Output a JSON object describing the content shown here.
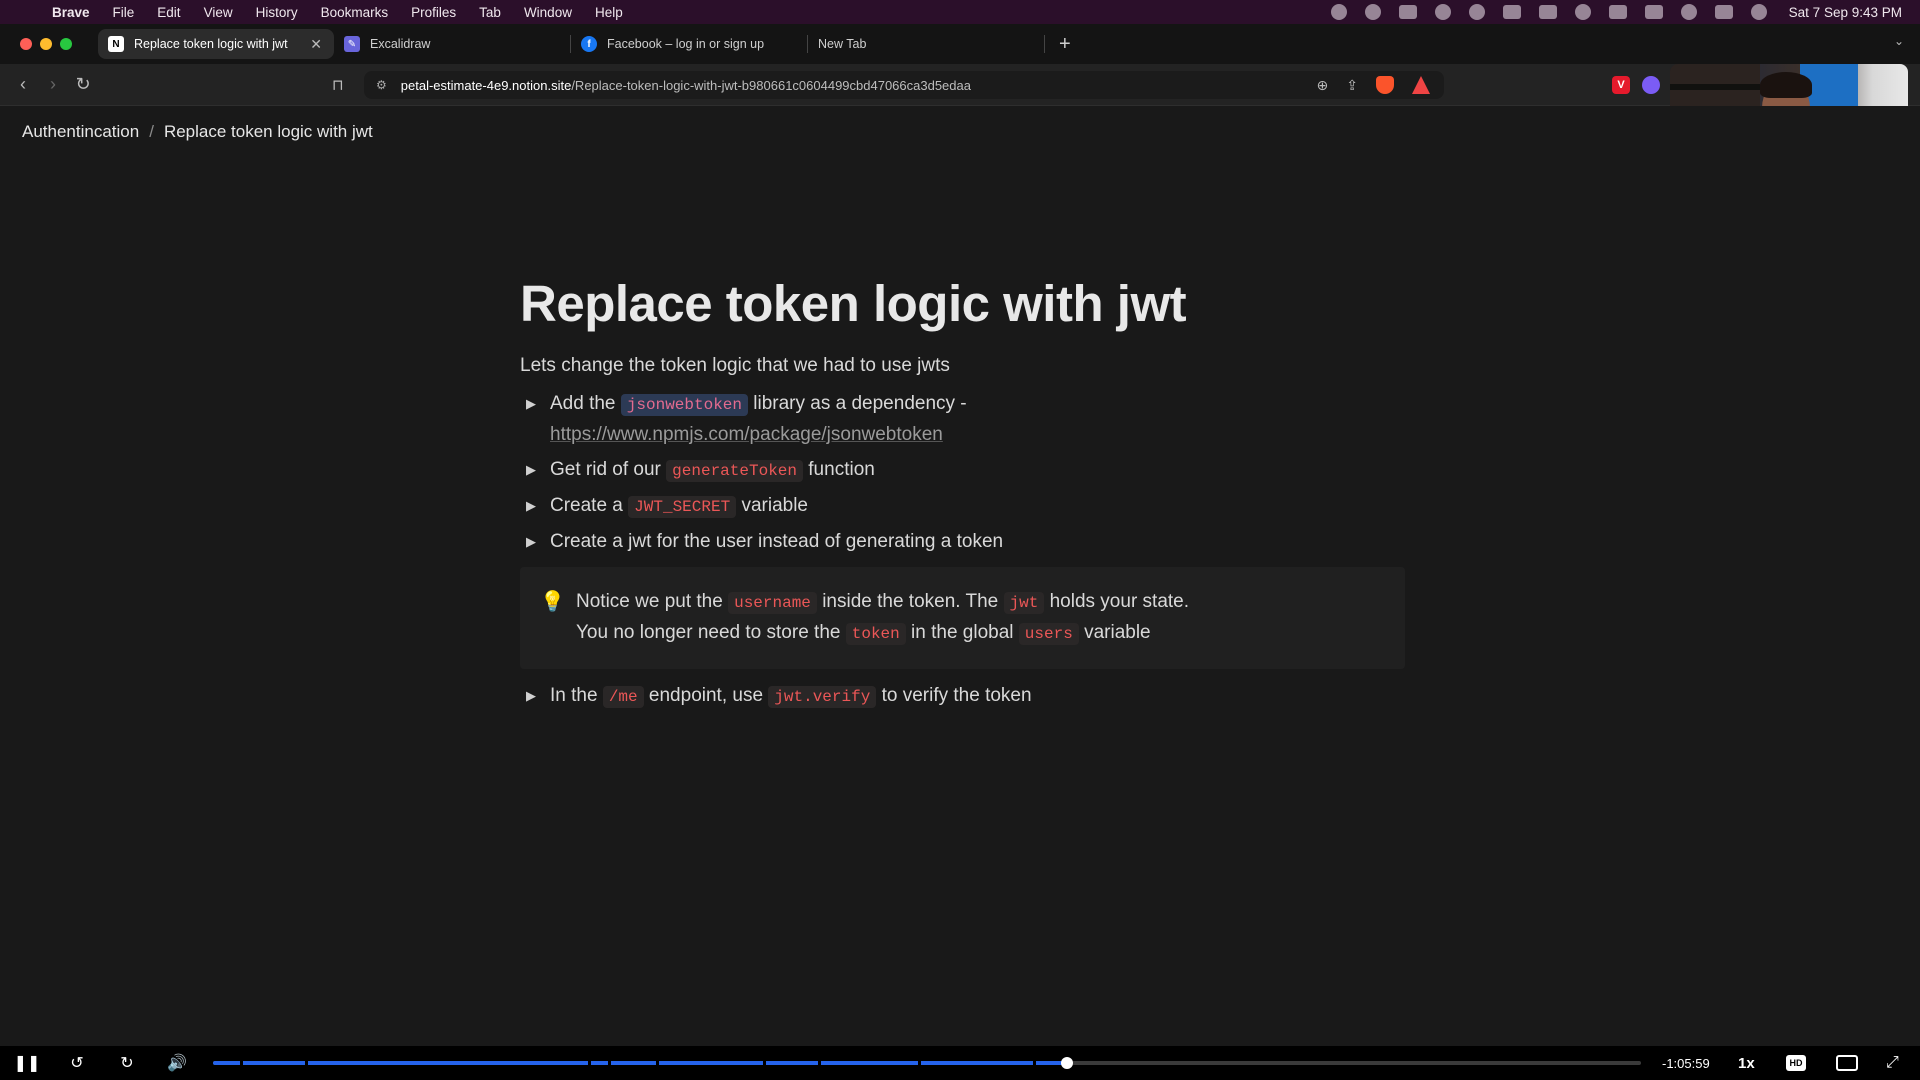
{
  "menubar": {
    "app": "Brave",
    "items": [
      "File",
      "Edit",
      "View",
      "History",
      "Bookmarks",
      "Profiles",
      "Tab",
      "Window",
      "Help"
    ],
    "clock": "Sat 7 Sep  9:43 PM"
  },
  "tabs": [
    {
      "label": "Replace token logic with jwt",
      "favicon": "N",
      "active": true
    },
    {
      "label": "Excalidraw",
      "favicon": "✎"
    },
    {
      "label": "Facebook – log in or sign up",
      "favicon": "f"
    },
    {
      "label": "New Tab",
      "favicon": ""
    }
  ],
  "toolbar": {
    "url_host": "petal-estimate-4e9.notion.site",
    "url_path": "/Replace-token-logic-with-jwt-b980661c0604499cbd47066ca3d5edaa",
    "rewards_badge": "1"
  },
  "page": {
    "breadcrumb": [
      "Authentincation",
      "Replace token logic with jwt"
    ],
    "title": "Replace token logic with jwt",
    "intro": "Lets change the token logic that we had to use jwts",
    "toggles": [
      {
        "pre": "Add the",
        "code": "jsonwebtoken",
        "post": "library as a dependency -",
        "link": "https://www.npmjs.com/package/jsonwebtoken"
      },
      {
        "pre": "Get rid of our",
        "code": "generateToken",
        "post": "function"
      },
      {
        "pre": "Create a",
        "code": "JWT_SECRET",
        "post": "variable"
      },
      {
        "text": "Create a jwt for the user instead of generating a token"
      }
    ],
    "callout": {
      "line1_a": "Notice we put the",
      "line1_code1": "username",
      "line1_b": "inside the token. The",
      "line1_code2": "jwt",
      "line1_c": "holds your state.",
      "line2_a": "You no longer need to store the",
      "line2_code1": "token",
      "line2_b": "in the global",
      "line2_code2": "users",
      "line2_c": "variable"
    },
    "last_toggle": {
      "pre": "In the",
      "code1": "/me",
      "mid": "endpoint, use",
      "code2": "jwt.verify",
      "post": "to verify the token"
    }
  },
  "player": {
    "time_remaining": "-1:05:59",
    "speed": "1x",
    "hd": "HD",
    "progress": 0.598
  },
  "colors": {
    "menubar_bg": "#2b0f2a",
    "page_bg": "#191919",
    "code_red": "#eb5757",
    "progress_blue": "#2563eb"
  }
}
